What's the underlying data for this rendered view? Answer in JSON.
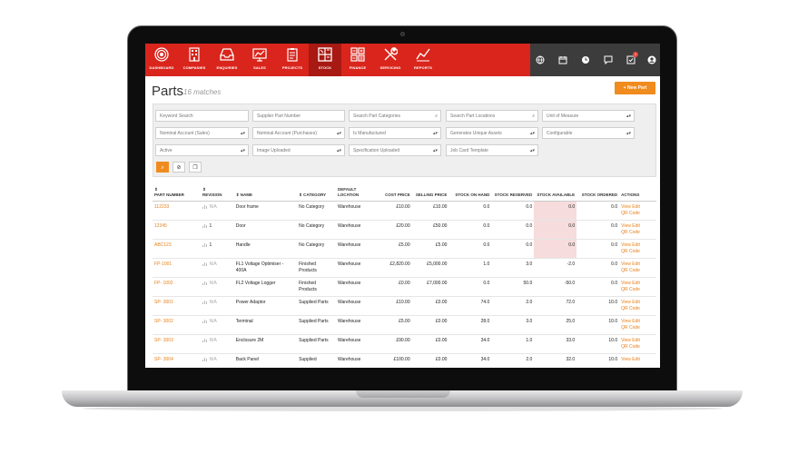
{
  "nav": {
    "items": [
      {
        "label": "DASHBOARD",
        "icon": "dashboard-icon"
      },
      {
        "label": "COMPANIES",
        "icon": "companies-icon"
      },
      {
        "label": "ENQUIRIES",
        "icon": "enquiries-icon"
      },
      {
        "label": "SALES",
        "icon": "sales-icon"
      },
      {
        "label": "PROJECTS",
        "icon": "projects-icon"
      },
      {
        "label": "STOCK",
        "icon": "stock-icon",
        "active": true
      },
      {
        "label": "FINANCE",
        "icon": "finance-icon"
      },
      {
        "label": "SERVICING",
        "icon": "servicing-icon"
      },
      {
        "label": "REPORTS",
        "icon": "reports-icon"
      }
    ],
    "right_icons": [
      "globe-icon",
      "calendar-icon",
      "clock-icon",
      "chat-icon",
      "tasks-icon",
      "user-icon"
    ],
    "notification_count": "1"
  },
  "page": {
    "title": "Parts",
    "matches": "16 matches",
    "new_button": "+ New Part"
  },
  "filters": {
    "keyword": "Keyword Search",
    "supplier_part": "Supplier Part Number",
    "part_categories": "Search Part Categories",
    "part_locations": "Search Part Locations",
    "unit_of_measure": "Unit of Measure",
    "nominal_sales": "Nominal Account (Sales)",
    "nominal_purchases": "Nominal Account (Purchases)",
    "is_manufactured": "Is Manufactured",
    "unique_assets": "Generates Unique Assets",
    "configurable": "Configurable",
    "active": "Active",
    "image_uploaded": "Image Uploaded",
    "spec_uploaded": "Specification Uploaded",
    "job_card": "Job Card Template"
  },
  "table": {
    "headers": {
      "part_number": "PART NUMBER",
      "revision": "REVISION",
      "name": "NAME",
      "category": "CATEGORY",
      "location": "DEFAULT LOCATION",
      "cost": "COST PRICE",
      "selling": "SELLING PRICE",
      "on_hand": "STOCK ON HAND",
      "reserved": "STOCK RESERVED",
      "available": "STOCK AVAILABLE",
      "ordered": "STOCK ORDERED",
      "actions": "ACTIONS"
    },
    "rows": [
      {
        "part": "112233",
        "rev": "N/A",
        "name": "Door frame",
        "cat": "No Category",
        "loc": "Warehouse",
        "cost": "£10.00",
        "sell": "£10.00",
        "onhand": "0.0",
        "reserved": "0.0",
        "available": "0.0",
        "ordered": "0.0",
        "view": "View",
        "edit": "Edit",
        "qr": "QR Code",
        "highlight": true
      },
      {
        "part": "12345",
        "rev": "1",
        "name": "Door",
        "cat": "No Category",
        "loc": "Warehouse",
        "cost": "£20.00",
        "sell": "£50.00",
        "onhand": "0.0",
        "reserved": "0.0",
        "available": "0.0",
        "ordered": "0.0",
        "view": "View",
        "edit": "Edit",
        "qr": "QR Code",
        "highlight": true
      },
      {
        "part": "ABC123",
        "rev": "1",
        "name": "Handle",
        "cat": "No Category",
        "loc": "Warehouse",
        "cost": "£5.00",
        "sell": "£5.00",
        "onhand": "0.0",
        "reserved": "0.0",
        "available": "0.0",
        "ordered": "0.0",
        "view": "View",
        "edit": "Edit",
        "qr": "QR Code",
        "highlight": true
      },
      {
        "part": "FP-1001",
        "rev": "N/A",
        "name": "FL1 Voltage Optimiser - 400A",
        "cat": "Finished Products",
        "loc": "Warehouse",
        "cost": "£2,820.00",
        "sell": "£5,000.00",
        "onhand": "1.0",
        "reserved": "3.0",
        "available": "-2.0",
        "ordered": "0.0",
        "view": "View",
        "edit": "Edit",
        "qr": "QR Code",
        "highlight": false
      },
      {
        "part": "FP- 1002",
        "rev": "N/A",
        "name": "FL2 Voltage Logger",
        "cat": "Finished Products",
        "loc": "Warehouse",
        "cost": "£0.00",
        "sell": "£7,000.00",
        "onhand": "0.0",
        "reserved": "50.0",
        "available": "-50.0",
        "ordered": "0.0",
        "view": "View",
        "edit": "Edit",
        "qr": "QR Code",
        "highlight": false
      },
      {
        "part": "SP- 3001",
        "rev": "N/A",
        "name": "Power Adaptor",
        "cat": "Supplied Parts",
        "loc": "Warehouse",
        "cost": "£10.00",
        "sell": "£0.00",
        "onhand": "74.0",
        "reserved": "2.0",
        "available": "72.0",
        "ordered": "10.0",
        "view": "View",
        "edit": "Edit",
        "qr": "QR Code",
        "highlight": false
      },
      {
        "part": "SP- 3002",
        "rev": "N/A",
        "name": "Terminal",
        "cat": "Supplied Parts",
        "loc": "Warehouse",
        "cost": "£5.00",
        "sell": "£0.00",
        "onhand": "28.0",
        "reserved": "3.0",
        "available": "25.0",
        "ordered": "10.0",
        "view": "View",
        "edit": "Edit",
        "qr": "QR Code",
        "highlight": false
      },
      {
        "part": "SP- 3003",
        "rev": "N/A",
        "name": "Enclosure 2M",
        "cat": "Supplied Parts",
        "loc": "Warehouse",
        "cost": "£90.00",
        "sell": "£0.00",
        "onhand": "34.0",
        "reserved": "1.0",
        "available": "33.0",
        "ordered": "10.0",
        "view": "View",
        "edit": "Edit",
        "qr": "QR Code",
        "highlight": false
      },
      {
        "part": "SP- 3004",
        "rev": "N/A",
        "name": "Back Panel",
        "cat": "Supplied",
        "loc": "Warehouse",
        "cost": "£100.00",
        "sell": "£0.00",
        "onhand": "34.0",
        "reserved": "2.0",
        "available": "32.0",
        "ordered": "10.0",
        "view": "View",
        "edit": "Edit",
        "qr": "",
        "highlight": false
      }
    ]
  }
}
